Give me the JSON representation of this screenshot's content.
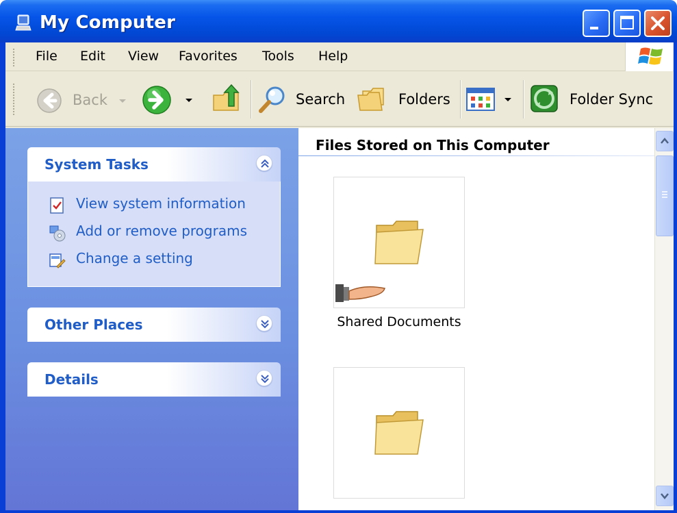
{
  "window": {
    "title": "My Computer",
    "buttons": {
      "minimize": "minimize",
      "maximize": "maximize",
      "close": "close"
    }
  },
  "menu": {
    "items": [
      "File",
      "Edit",
      "View",
      "Favorites",
      "Tools",
      "Help"
    ]
  },
  "toolbar": {
    "back_label": "Back",
    "search_label": "Search",
    "folders_label": "Folders",
    "folder_sync_label": "Folder Sync"
  },
  "left_pane": {
    "system_tasks": {
      "title": "System Tasks",
      "items": [
        "View system information",
        "Add or remove programs",
        "Change a setting"
      ]
    },
    "other_places": {
      "title": "Other Places"
    },
    "details": {
      "title": "Details"
    }
  },
  "right_pane": {
    "group_title": "Files Stored on This Computer",
    "items": [
      {
        "label": "Shared Documents",
        "shared": true
      },
      {
        "label": "",
        "shared": false
      }
    ]
  },
  "colors": {
    "titlebar": "#0655e8",
    "task_link": "#215dc6",
    "leftpane": "#7ba2e7",
    "close_button": "#d8532d"
  }
}
